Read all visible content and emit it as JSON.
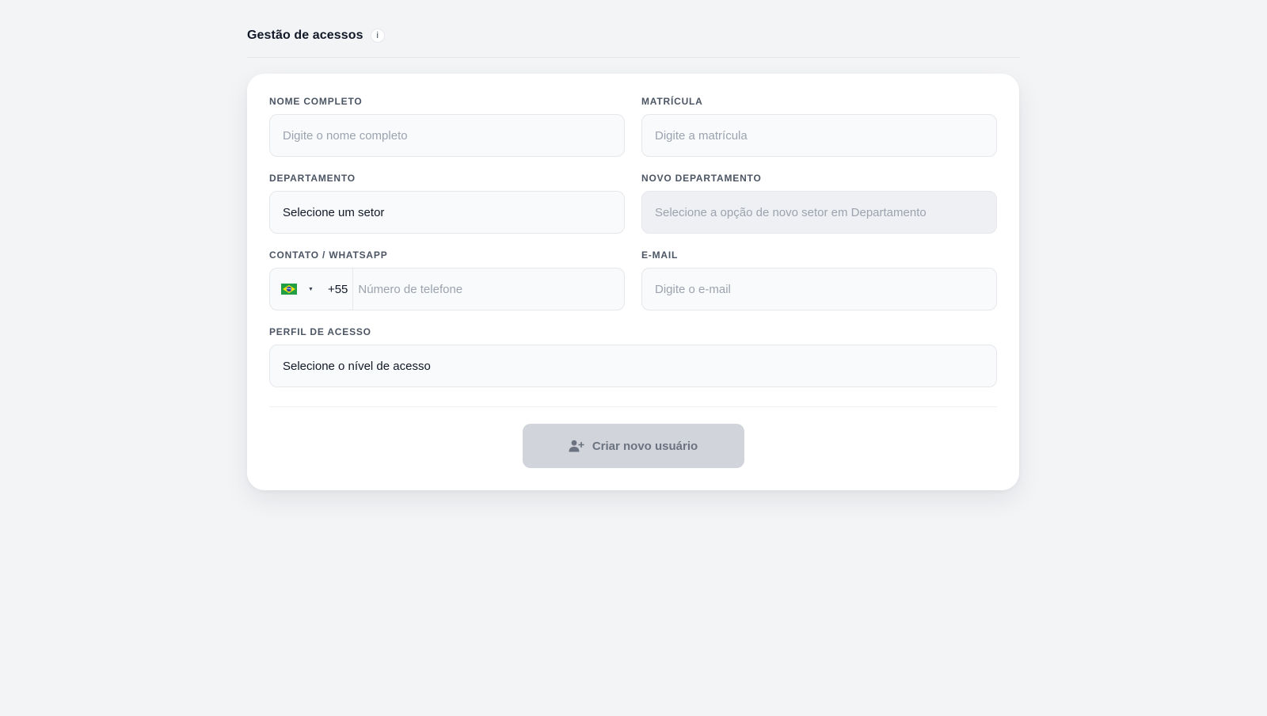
{
  "header": {
    "title": "Gestão de acessos",
    "info_icon_text": "i"
  },
  "form": {
    "nome": {
      "label": "NOME COMPLETO",
      "placeholder": "Digite o nome completo"
    },
    "matricula": {
      "label": "MATRÍCULA",
      "placeholder": "Digite a matrícula"
    },
    "departamento": {
      "label": "DEPARTAMENTO",
      "selected": "Selecione um setor"
    },
    "novo_departamento": {
      "label": "NOVO DEPARTAMENTO",
      "placeholder": "Selecione a opção de novo setor em Departamento"
    },
    "contato": {
      "label": "CONTATO / WHATSAPP",
      "country_flag": "brazil-flag-icon",
      "dial_code": "+55",
      "placeholder": "Número de telefone"
    },
    "email": {
      "label": "E-MAIL",
      "placeholder": "Digite o e-mail"
    },
    "perfil": {
      "label": "PERFIL DE ACESSO",
      "selected": "Selecione o nível de acesso"
    }
  },
  "actions": {
    "create_label": "Criar novo usuário",
    "create_icon": "user-plus-icon",
    "create_disabled": true
  },
  "colors": {
    "background": "#f3f4f6",
    "card": "#ffffff",
    "button_disabled": "#d1d5db",
    "placeholder": "#9ca3af"
  }
}
